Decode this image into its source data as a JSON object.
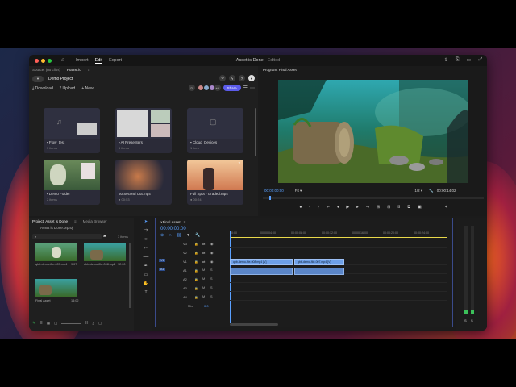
{
  "titlebar": {
    "nav": [
      "Import",
      "Edit",
      "Export"
    ],
    "active_nav": "Edit",
    "title": "Asset is Done",
    "subtitle": "- Edited"
  },
  "project": {
    "tabs": [
      "Source: (no clips)",
      "Frame.io"
    ],
    "name": "Demo Project",
    "actions": [
      "Download",
      "Upload",
      "New"
    ],
    "share_label": "Share",
    "avatar_count": "+5",
    "cards": [
      {
        "name": "Flow_test",
        "meta": "3 items",
        "kind": "folder"
      },
      {
        "name": "AI Presenters",
        "meta": "6 items",
        "kind": "folder"
      },
      {
        "name": "Cloud_Devices",
        "meta": "1 item",
        "kind": "folder"
      },
      {
        "name": "Demo Folder",
        "meta": "2 items",
        "kind": "folder"
      },
      {
        "name": "60 Second Cut.mp4",
        "meta": "00:53",
        "kind": "video"
      },
      {
        "name": "Full Spot - Graded.mp4",
        "meta": "00:24",
        "kind": "video",
        "badge": "2"
      }
    ]
  },
  "program": {
    "title": "Program: Final Asset",
    "timecode": "00:00:00:00",
    "fit": "Fit",
    "ratio": "1/2",
    "duration": "00:00:14:02",
    "progress": 0.03
  },
  "project_bottom": {
    "tabs": [
      "Project: Asset is Done",
      "Media Browser"
    ],
    "file": "Asset is Done.prproj",
    "count": "3 items",
    "clips": [
      {
        "label": "qbb-demo-file-007.mp4",
        "dur": "9:07"
      },
      {
        "label": "qbb-demo-file-008.mp4",
        "dur": "12:00"
      },
      {
        "label": "Final Asset",
        "dur": "14:02"
      }
    ]
  },
  "timeline": {
    "tab": "Final Asset",
    "timecode": "00:00:00:00",
    "ruler": [
      "00:00",
      "00:00:04:00",
      "00:00:08:00",
      "00:00:12:00",
      "00:00:16:00",
      "00:00:20:00",
      "00:00:24:00"
    ],
    "tracks_video": [
      "V3",
      "V2",
      "V1"
    ],
    "tracks_audio": [
      "A1",
      "A2",
      "A3",
      "A4"
    ],
    "mix_label": "Mix",
    "mix_value": "0.0",
    "clips": [
      "qbb-demo-file-008.mp4 [V]",
      "qbb-demo-file-007.mp4 [V]"
    ]
  },
  "meter": {
    "labels": [
      "S",
      "S"
    ],
    "level": 0.05
  }
}
